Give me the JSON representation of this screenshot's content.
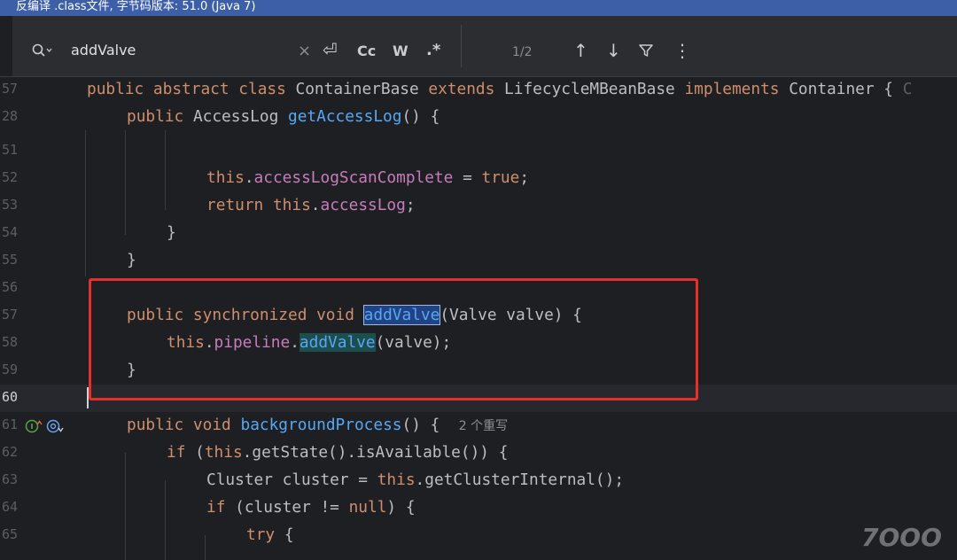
{
  "window": {
    "title": "反编译 .class文件, 字节码版本: 51.0 (Java 7)"
  },
  "search": {
    "query": "addValve",
    "match_count": "1/2",
    "clear_icon": "×",
    "newline_icon": "⏎",
    "case_label": "Cc",
    "words_label": "W",
    "regex_label": ".*",
    "prev_icon": "↑",
    "next_icon": "↓",
    "filter_icon": "filter",
    "more_icon": "⋮"
  },
  "gutter": {
    "line_numbers": [
      "57",
      "28",
      "",
      "51",
      "52",
      "53",
      "54",
      "55",
      "56",
      "57",
      "58",
      "59",
      "60",
      "61",
      "62",
      "63",
      "64",
      "65"
    ]
  },
  "code": {
    "l57": {
      "kw1": "public abstract class",
      "cls": " ContainerBase ",
      "kw2": "extends",
      "sup": " LifecycleMBeanBase ",
      "kw3": "implements",
      "iface": " Container {",
      "trail": "C"
    },
    "l28": {
      "kw": "public",
      "type": " AccessLog ",
      "method": "getAccessLog",
      "rest": "() {"
    },
    "l52": {
      "kw": "this",
      "dot": ".",
      "field": "accessLogScanComplete",
      "op": " = ",
      "val": "true",
      "end": ";"
    },
    "l53": {
      "kw": "return",
      "sp": " ",
      "kw2": "this",
      "dot": ".",
      "field": "accessLog",
      "end": ";"
    },
    "l54": {
      "brace": "}"
    },
    "l55": {
      "brace": "}"
    },
    "l57b": {
      "kw": "public synchronized void",
      "sp": " ",
      "method": "addValve",
      "rest": "(Valve valve) {"
    },
    "l58": {
      "kw": "this",
      "dot": ".",
      "field": "pipeline",
      "dot2": ".",
      "method": "addValve",
      "rest": "(valve);"
    },
    "l59": {
      "brace": "}"
    },
    "l61": {
      "kw": "public void",
      "sp": " ",
      "method": "backgroundProcess",
      "rest": "() {",
      "hint": "2 个重写"
    },
    "l62": {
      "kw": "if",
      "rest1": " (",
      "kw2": "this",
      "rest2": ".getState().isAvailable()) {"
    },
    "l63": {
      "text1": "Cluster cluster = ",
      "kw": "this",
      "text2": ".getClusterInternal();"
    },
    "l64": {
      "kw": "if",
      "text1": " (cluster != ",
      "kw2": "null",
      "text2": ") {"
    },
    "l65": {
      "kw": "try",
      "text": " {"
    }
  },
  "watermark": "7OOO"
}
